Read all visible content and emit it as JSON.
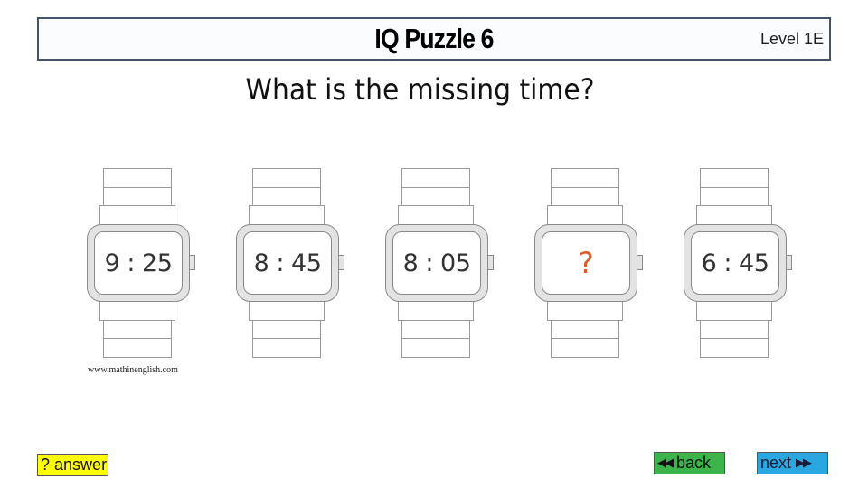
{
  "header": {
    "title": "IQ Puzzle 6",
    "level": "Level 1E"
  },
  "question": "What is the missing time?",
  "watches": [
    {
      "time": "9 : 25",
      "missing": false
    },
    {
      "time": "8 : 45",
      "missing": false
    },
    {
      "time": "8 : 05",
      "missing": false
    },
    {
      "time": "?",
      "missing": true
    },
    {
      "time": "6 : 45",
      "missing": false
    }
  ],
  "credit": "www.mathinenglish.com",
  "colors": {
    "missing_mark": "#e05a24",
    "answer_button": "#ffff00",
    "back_button": "#3cb44b",
    "next_button": "#29a7e1",
    "title_border": "#44546a"
  },
  "buttons": {
    "answer": {
      "icon": "question-mark",
      "label": "answer",
      "prefix": "?"
    },
    "back": {
      "icon": "double-left-triangle",
      "label": "back",
      "glyph": "◀◀"
    },
    "next": {
      "icon": "double-right-triangle",
      "label": "next",
      "glyph": "▶▶"
    }
  }
}
